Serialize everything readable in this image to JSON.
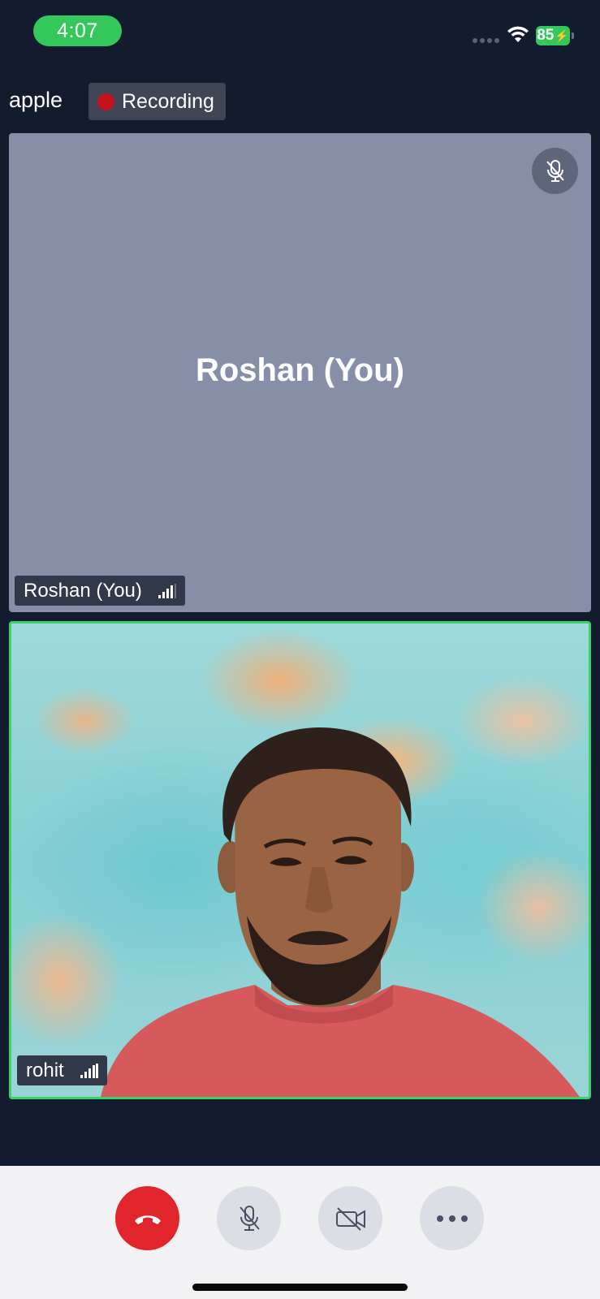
{
  "status_bar": {
    "time": "4:07",
    "battery": "85"
  },
  "meeting": {
    "name": "apple",
    "recording_label": "Recording"
  },
  "tiles": [
    {
      "name_center": "Roshan (You)",
      "name_tag": "Roshan (You)",
      "mic_muted": true,
      "background": "#878ea8"
    },
    {
      "name_tag": "rohit",
      "active_speaker": true,
      "highlight_color": "#3bd26a"
    }
  ],
  "controls": [
    {
      "icon": "end-call-icon",
      "color": "#e0262c"
    },
    {
      "icon": "mic-off-icon"
    },
    {
      "icon": "video-off-icon"
    },
    {
      "icon": "more-icon"
    }
  ],
  "colors": {
    "background": "#131b2e",
    "accent_green": "#34c759",
    "recording_red": "#c4111b"
  }
}
